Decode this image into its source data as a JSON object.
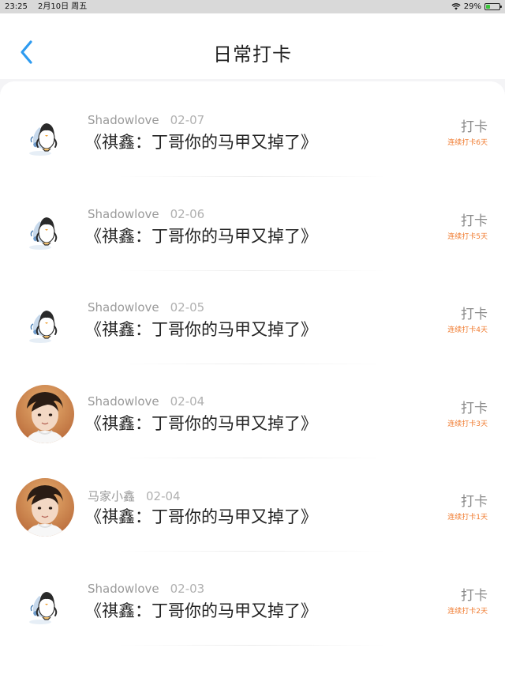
{
  "status_bar": {
    "time": "23:25",
    "date": "2月10日 周五",
    "battery_percent": "29%",
    "battery_level": 0.29
  },
  "header": {
    "title": "日常打卡",
    "back_icon": "chevron-left-icon"
  },
  "items": [
    {
      "user": "Shadowlove",
      "date": "02-07",
      "topic": "《祺鑫：丁哥你的马甲又掉了》",
      "button": "打卡",
      "streak": "连续打卡6天",
      "avatar": "penguin"
    },
    {
      "user": "Shadowlove",
      "date": "02-06",
      "topic": "《祺鑫：丁哥你的马甲又掉了》",
      "button": "打卡",
      "streak": "连续打卡5天",
      "avatar": "penguin"
    },
    {
      "user": "Shadowlove",
      "date": "02-05",
      "topic": "《祺鑫：丁哥你的马甲又掉了》",
      "button": "打卡",
      "streak": "连续打卡4天",
      "avatar": "penguin"
    },
    {
      "user": "Shadowlove",
      "date": "02-04",
      "topic": "《祺鑫：丁哥你的马甲又掉了》",
      "button": "打卡",
      "streak": "连续打卡3天",
      "avatar": "photo"
    },
    {
      "user": "马家小鑫",
      "date": "02-04",
      "topic": "《祺鑫：丁哥你的马甲又掉了》",
      "button": "打卡",
      "streak": "连续打卡1天",
      "avatar": "photo"
    },
    {
      "user": "Shadowlove",
      "date": "02-03",
      "topic": "《祺鑫：丁哥你的马甲又掉了》",
      "button": "打卡",
      "streak": "连续打卡2天",
      "avatar": "penguin"
    }
  ],
  "colors": {
    "accent": "#2e9bf0",
    "streak": "#f07a2e"
  }
}
